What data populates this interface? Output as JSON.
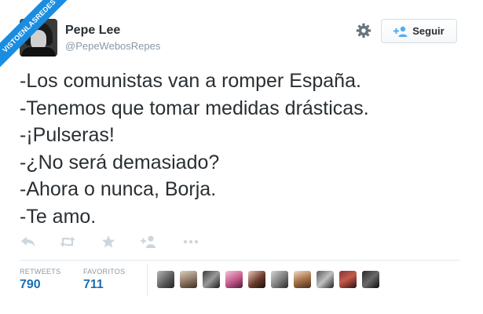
{
  "watermark": "VISTOENLASREDES",
  "user": {
    "name": "Pepe Lee",
    "handle": "@PepeWebosRepes"
  },
  "follow_button": {
    "label": "Seguir",
    "icon": "add-user-icon"
  },
  "settings": {
    "icon": "gear-icon"
  },
  "tweet": {
    "lines": [
      "-Los comunistas van a romper España.",
      "-Tenemos que tomar medidas drásticas.",
      "-¡Pulseras!",
      "-¿No será demasiado?",
      "-Ahora o nunca, Borja.",
      "-Te amo."
    ]
  },
  "actions": [
    {
      "name": "reply",
      "icon": "reply-icon"
    },
    {
      "name": "retweet",
      "icon": "retweet-icon"
    },
    {
      "name": "favorite",
      "icon": "star-icon"
    },
    {
      "name": "follow",
      "icon": "add-user-icon"
    },
    {
      "name": "more",
      "icon": "more-icon"
    }
  ],
  "stats": {
    "retweets": {
      "label": "RETWEETS",
      "value": "790"
    },
    "favorites": {
      "label": "FAVORITOS",
      "value": "711"
    }
  },
  "colors": {
    "accent": "#1b6eb4",
    "watermark_bg": "#1b8de0",
    "muted": "#8899a6",
    "text": "#292f33",
    "divider": "#e1e8ed"
  }
}
